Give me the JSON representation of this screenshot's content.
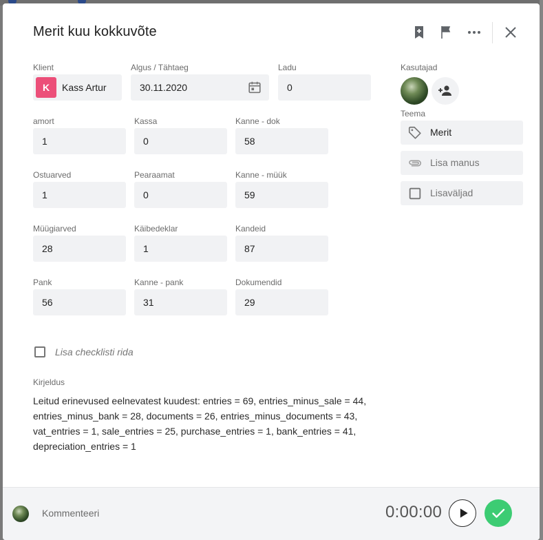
{
  "dialog": {
    "title": "Merit kuu kokkuvõte",
    "header_icons": [
      "bookmark-add-icon",
      "flag-icon",
      "more-icon",
      "close-icon"
    ]
  },
  "fields": {
    "klient": {
      "label": "Klient",
      "avatar_letter": "K",
      "value": "Kass Artur",
      "avatar_color": "#ec4f79"
    },
    "algus": {
      "label": "Algus / Tähtaeg",
      "value": "30.11.2020"
    },
    "ladu": {
      "label": "Ladu",
      "value": "0"
    },
    "amort": {
      "label": "amort",
      "value": "1"
    },
    "kassa": {
      "label": "Kassa",
      "value": "0"
    },
    "kanne_dok": {
      "label": "Kanne - dok",
      "value": "58"
    },
    "ostuarved": {
      "label": "Ostuarved",
      "value": "1"
    },
    "pearaamat": {
      "label": "Pearaamat",
      "value": "0"
    },
    "kanne_myyk": {
      "label": "Kanne - müük",
      "value": "59"
    },
    "myygiarved": {
      "label": "Müügiarved",
      "value": "28"
    },
    "kaibedeklar": {
      "label": "Käibedeklar",
      "value": "1"
    },
    "kandeid": {
      "label": "Kandeid",
      "value": "87"
    },
    "pank": {
      "label": "Pank",
      "value": "56"
    },
    "kanne_pank": {
      "label": "Kanne - pank",
      "value": "31"
    },
    "dokumendid": {
      "label": "Dokumendid",
      "value": "29"
    }
  },
  "sidebar": {
    "kasutajad_label": "Kasutajad",
    "teema_label": "Teema",
    "teema_value": "Merit",
    "lisa_manus": "Lisa manus",
    "lisavaljad": "Lisaväljad"
  },
  "checklist": {
    "placeholder": "Lisa checklisti rida"
  },
  "description": {
    "label": "Kirjeldus",
    "text": "Leitud erinevused eelnevatest kuudest: entries = 69, entries_minus_sale = 44, entries_minus_bank = 28, documents = 26, entries_minus_documents = 43, vat_entries = 1, sale_entries = 25, purchase_entries = 1, bank_entries = 41, depreciation_entries = 1"
  },
  "footer": {
    "comment_placeholder": "Kommenteeri",
    "timer": "0:00:00"
  },
  "colors": {
    "accent_green": "#3ccc73",
    "field_bg": "#f1f2f4"
  }
}
